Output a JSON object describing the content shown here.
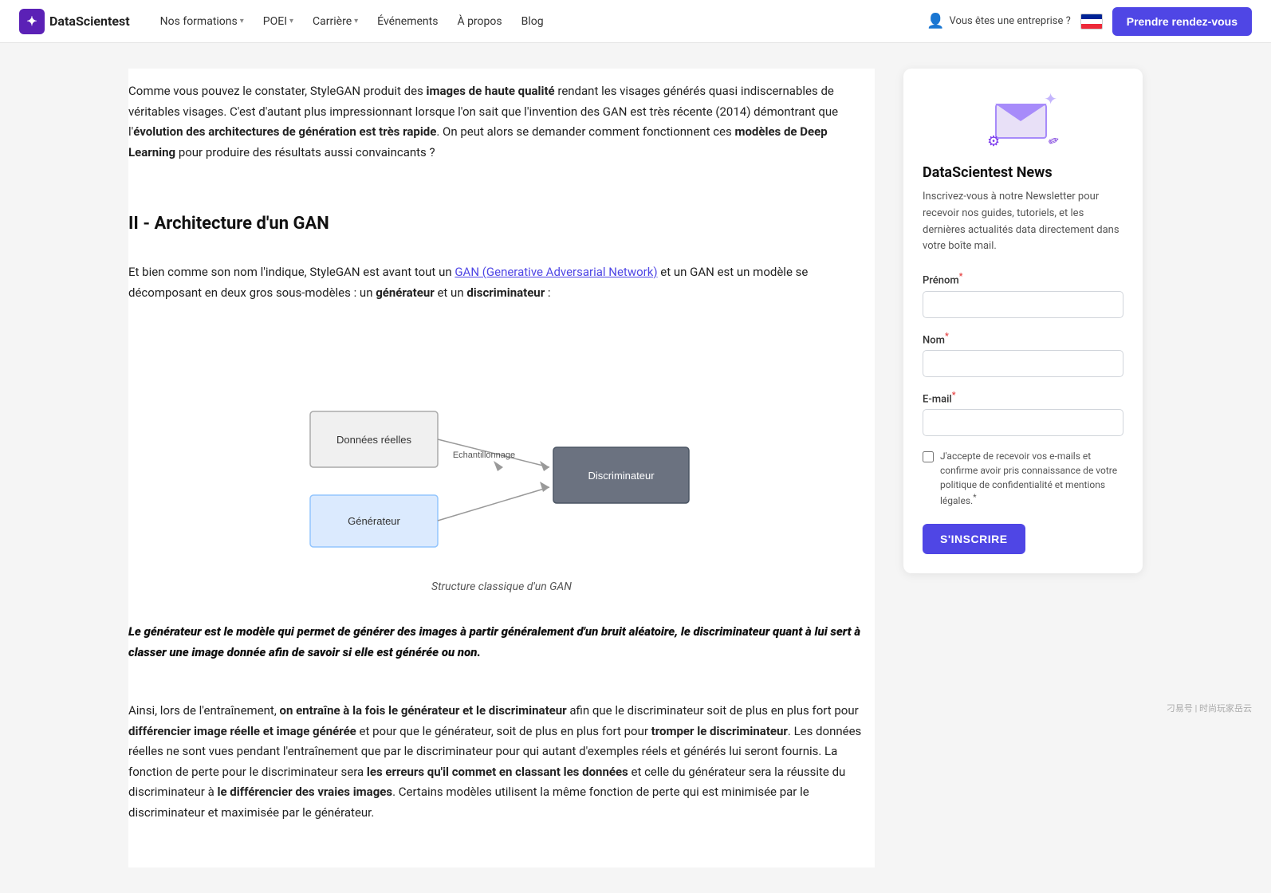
{
  "navbar": {
    "logo_text": "DataScientest",
    "nav_items": [
      {
        "label": "Nos formations",
        "has_dropdown": true
      },
      {
        "label": "POEI",
        "has_dropdown": true
      },
      {
        "label": "Carrière",
        "has_dropdown": true
      },
      {
        "label": "Événements",
        "has_dropdown": false
      },
      {
        "label": "À propos",
        "has_dropdown": false
      },
      {
        "label": "Blog",
        "has_dropdown": false
      }
    ],
    "enterprise_label": "Vous êtes une entreprise ?",
    "cta_label": "Prendre rendez-vous"
  },
  "article": {
    "intro_paragraph": "Comme vous pouvez le constater, StyleGAN produit des images de haute qualité rendant les visages générés quasi indiscernables de véritables visages. C'est d'autant plus impressionnant lorsque l'on sait que l'invention des GAN est très récente (2014) démontrant que l'évolution des architectures de génération est très rapide. On peut alors se demander comment fonctionnent ces modèles de Deep Learning pour produire des résultats aussi convaincants ?",
    "section2_title": "II - Architecture d'un GAN",
    "section2_intro": "Et bien comme son nom l'indique, StyleGAN est avant tout un ",
    "gan_link_text": "GAN (Generative Adversarial Network)",
    "section2_intro2": " et un GAN est un modèle se décomposant en deux gros sous-modèles : un ",
    "generateur_bold": "générateur",
    "section2_intro3": " et un ",
    "discriminateur_bold": "discriminateur",
    "section2_intro4": " :",
    "diagram_caption": "Structure classique d'un GAN",
    "diagram_labels": {
      "donnees_reelles": "Données réelles",
      "generateur": "Générateur",
      "echantillonnage": "Echantillonnage",
      "discriminateur": "Discriminateur"
    },
    "blockquote": "Le générateur est le modèle qui permet de générer des images à partir généralement d'un bruit aléatoire, le discriminateur quant à lui sert à classer une image donnée afin de savoir si elle est générée ou non.",
    "paragraph3_start": "Ainsi, lors de l'entraînement, ",
    "paragraph3_bold1": "on entraîne à la fois le générateur et le discriminateur",
    "paragraph3_mid1": " afin que le discriminateur soit de plus en plus fort pour ",
    "paragraph3_bold2": "différencier image réelle et image générée",
    "paragraph3_mid2": " et pour que le générateur, soit de plus en plus fort pour ",
    "paragraph3_bold3": "tromper le discriminateur",
    "paragraph3_mid3": ". Les données réelles ne sont vues pendant l'entraînement que par le discriminateur pour qui autant d'exemples réels et générés lui seront fournis. La fonction de perte pour le discriminateur sera ",
    "paragraph3_bold4": "les erreurs qu'il commet en classant les données",
    "paragraph3_mid4": " et celle du générateur sera la réussite du discriminateur à ",
    "paragraph3_bold5": "le différencier des vraies images",
    "paragraph3_end": ". Certains modèles utilisent la même fonction de perte qui est minimisée par le discriminateur et maximisée par le générateur."
  },
  "sidebar": {
    "title": "DataScientest News",
    "description": "Inscrivez-vous à notre Newsletter pour recevoir nos guides, tutoriels, et les dernières actualités data directement dans votre boîte mail.",
    "prenom_label": "Prénom",
    "nom_label": "Nom",
    "email_label": "E-mail",
    "checkbox_text": "J'accepte de recevoir vos e-mails et confirme avoir pris connaissance de votre politique de confidentialité et mentions légales.",
    "subscribe_label": "S'INSCRIRE"
  },
  "watermark": "刁易号 | 时尚玩家岳云"
}
